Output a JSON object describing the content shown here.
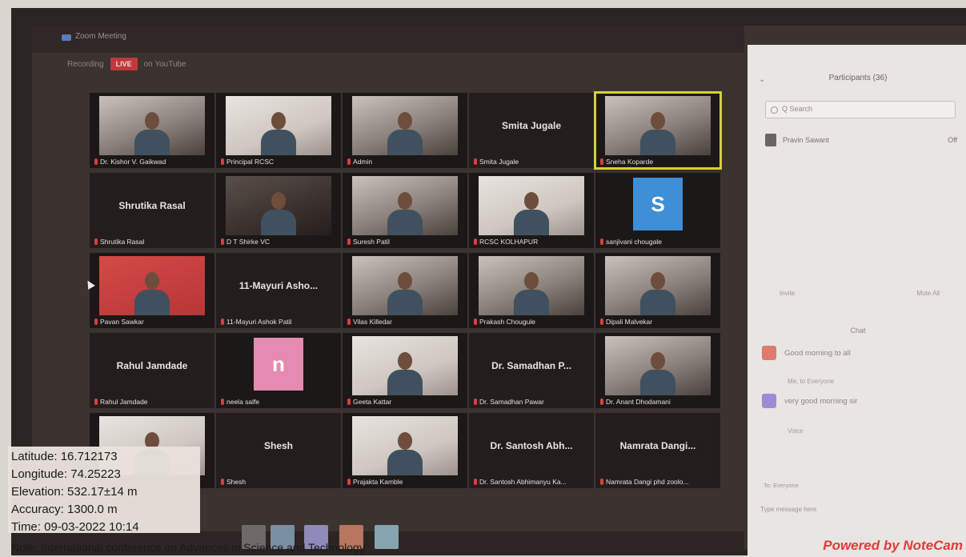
{
  "window": {
    "title": "Zoom Meeting"
  },
  "toolbar": {
    "items": [
      "Recording",
      "LIVE",
      "on YouTube"
    ]
  },
  "grid": {
    "tiles": [
      {
        "name": "Dr. Kishor V. Gaikwad",
        "type": "video",
        "shade": "mid"
      },
      {
        "name": "Principal RCSC",
        "type": "video",
        "shade": "light"
      },
      {
        "name": "Admin",
        "type": "video",
        "shade": "mid"
      },
      {
        "name": "Smita Jugale",
        "type": "text",
        "display": "Smita Jugale"
      },
      {
        "name": "Sneha Koparde",
        "type": "video",
        "shade": "mid",
        "active": true
      },
      {
        "name": "Shrutika Rasal",
        "type": "text",
        "display": "Shrutika Rasal"
      },
      {
        "name": "D T Shirke VC",
        "type": "video",
        "shade": "dark"
      },
      {
        "name": "Suresh Patil",
        "type": "video",
        "shade": "mid"
      },
      {
        "name": "RCSC KOLHAPUR",
        "type": "video",
        "shade": "light"
      },
      {
        "name": "sanjivani chougale",
        "type": "avatar",
        "letter": "S",
        "color": "blue"
      },
      {
        "name": "Pavan Sawkar",
        "type": "video",
        "shade": "red"
      },
      {
        "name": "11-Mayuri Ashok Patil",
        "type": "text",
        "display": "11-Mayuri Asho..."
      },
      {
        "name": "Vilas Killedar",
        "type": "video",
        "shade": "mid"
      },
      {
        "name": "Prakash Chougule",
        "type": "video",
        "shade": "mid"
      },
      {
        "name": "Dipali Malvekar",
        "type": "video",
        "shade": "mid"
      },
      {
        "name": "Rahul Jamdade",
        "type": "text",
        "display": "Rahul Jamdade"
      },
      {
        "name": "neela salfe",
        "type": "avatar",
        "letter": "n",
        "color": "pink"
      },
      {
        "name": "Geeta Kattar",
        "type": "video",
        "shade": "light"
      },
      {
        "name": "Dr. Samadhan Pawar",
        "type": "text",
        "display": "Dr. Samadhan P..."
      },
      {
        "name": "Dr. Anant Dhodamani",
        "type": "video",
        "shade": "mid"
      },
      {
        "name": "",
        "type": "video",
        "shade": "light"
      },
      {
        "name": "Shesh",
        "type": "text",
        "display": "Shesh"
      },
      {
        "name": "Prajakta Kamble",
        "type": "video",
        "shade": "light"
      },
      {
        "name": "Dr. Santosh Abhimanyu Ka...",
        "type": "text",
        "display": "Dr. Santosh Abh..."
      },
      {
        "name": "Namrata Dangi phd zoolo...",
        "type": "text",
        "display": "Namrata Dangi..."
      }
    ]
  },
  "panel": {
    "title": "Participants (36)",
    "search_placeholder": "Q Search",
    "participant_row": {
      "name": "Pravin Sawant",
      "status": "Off"
    },
    "buttons": {
      "left": "Invite",
      "right": "Mute All"
    },
    "chat_title": "Chat",
    "chat_messages": [
      {
        "text": "Good morning to all",
        "color": "#e07a6c"
      },
      {
        "text": "very good morning sir",
        "color": "#a08ad8"
      }
    ],
    "chat_sender": "Me, to Everyone",
    "chat_note": "Voice",
    "chat_to": "To: Everyone",
    "chat_input_placeholder": "Type message here"
  },
  "overlay": {
    "latitude": "Latitude: 16.712173",
    "longitude": "Longitude: 74.25223",
    "elevation": "Elevation: 532.17±14 m",
    "accuracy": "Accuracy: 1300.0 m",
    "time": "Time: 09-03-2022 10:14",
    "note": "Note: International conference on Advances in Science and Technology",
    "watermark": "Powered by NoteCam"
  }
}
